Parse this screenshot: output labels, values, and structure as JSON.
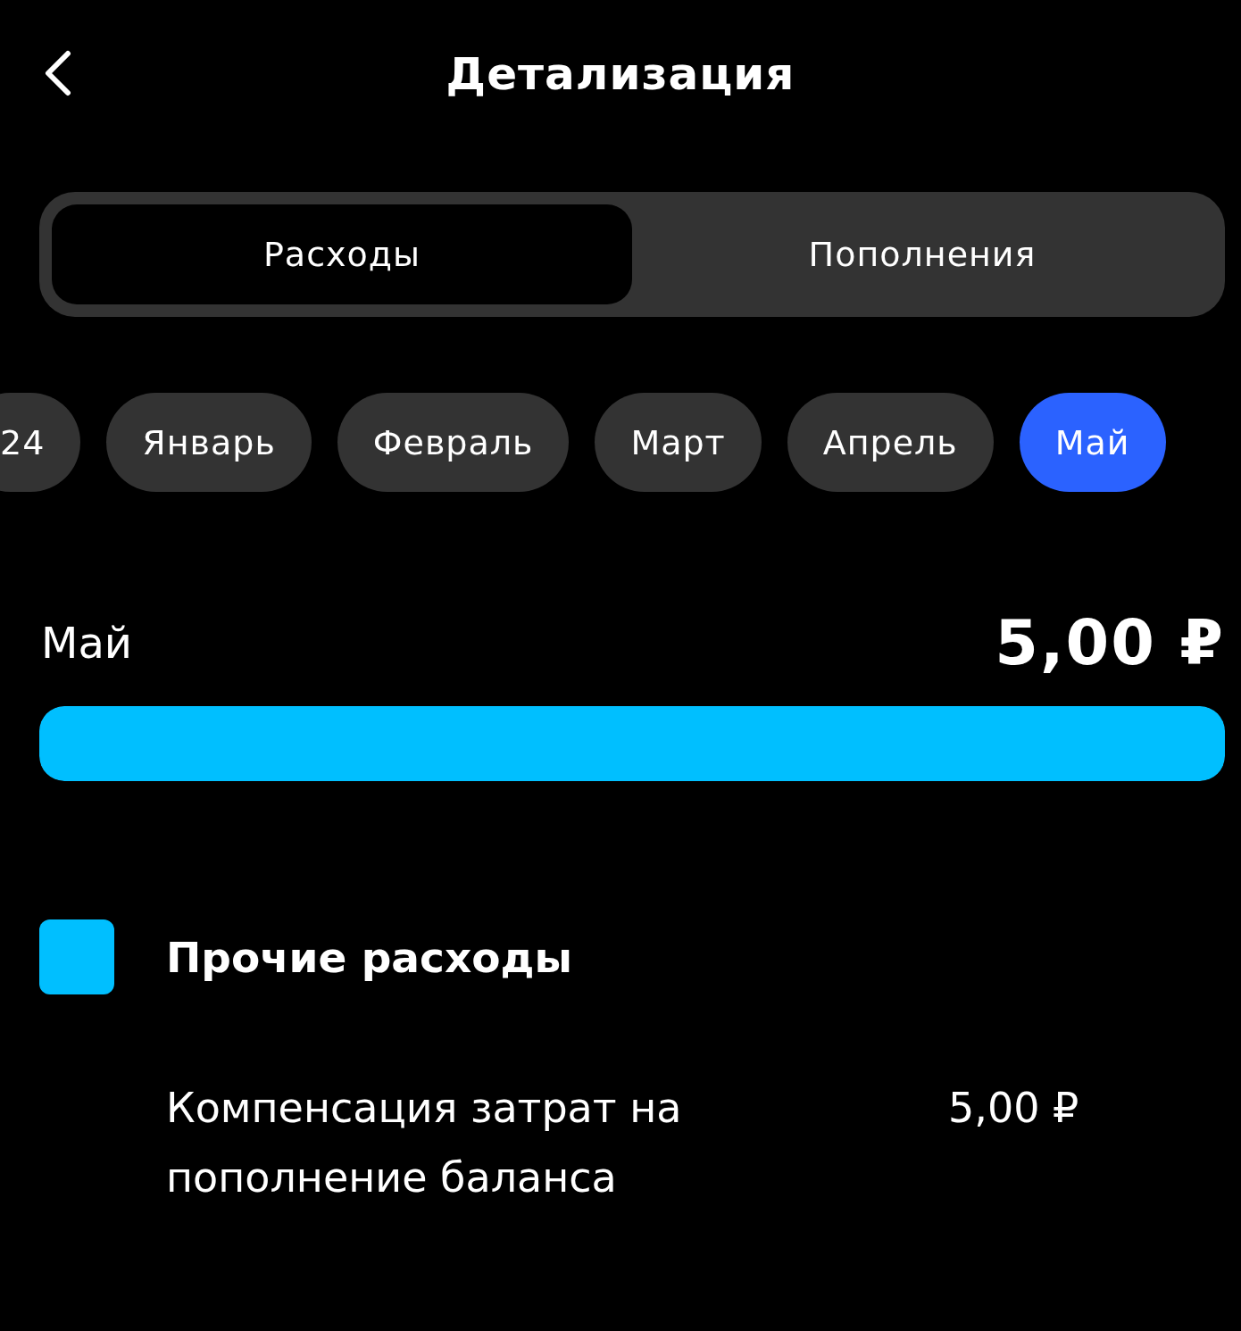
{
  "header": {
    "title": "Детализация"
  },
  "tabs": [
    {
      "label": "Расходы",
      "selected": true
    },
    {
      "label": "Пополнения",
      "selected": false
    }
  ],
  "months": [
    {
      "label": "24",
      "selected": false
    },
    {
      "label": "Январь",
      "selected": false
    },
    {
      "label": "Февраль",
      "selected": false
    },
    {
      "label": "Март",
      "selected": false
    },
    {
      "label": "Апрель",
      "selected": false
    },
    {
      "label": "Май",
      "selected": true
    }
  ],
  "summary": {
    "period": "Май",
    "total": "5,00 ₽",
    "level": 1
  },
  "categories": [
    {
      "name": "Прочие расходы",
      "color": "#00bfff",
      "items": [
        {
          "title": "Компенсация затрат на пополнение баланса",
          "amount": "5,00 ₽"
        }
      ]
    }
  ]
}
